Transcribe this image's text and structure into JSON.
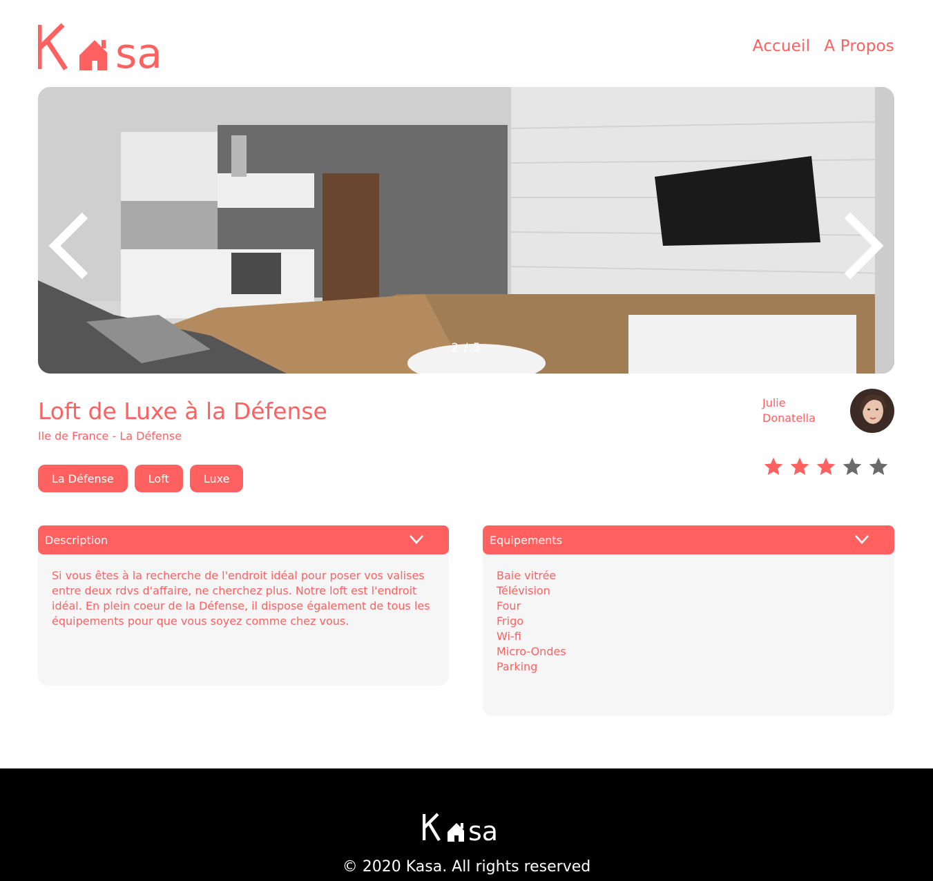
{
  "header": {
    "logo_text": "Kasa",
    "nav": [
      {
        "label": "Accueil"
      },
      {
        "label": "A Propos"
      }
    ]
  },
  "carousel": {
    "current": 2,
    "total": 5,
    "counter": "2 / 5"
  },
  "listing": {
    "title": "Loft de Luxe à la Défense",
    "location": "Ile de France - La Défense",
    "tags": [
      "La Défense",
      "Loft",
      "Luxe"
    ],
    "host": {
      "first_name": "Julie",
      "last_name": "Donatella"
    },
    "rating": 3,
    "rating_max": 5
  },
  "description": {
    "title": "Description",
    "text": "Si vous êtes à la recherche de l'endroit idéal pour poser vos valises entre deux rdvs d'affaire, ne cherchez plus. Notre loft est l'endroit idéal. En plein coeur de la Défense, il dispose également de tous les équipements pour que vous soyez comme chez vous."
  },
  "equipments": {
    "title": "Equipements",
    "items": [
      "Baie vitrée",
      "Télévision",
      "Four",
      "Frigo",
      "Wi-fi",
      "Micro-Ondes",
      "Parking"
    ]
  },
  "footer": {
    "logo_text": "Kasa",
    "copyright": "© 2020 Kasa. All rights reserved"
  },
  "colors": {
    "primary": "#FF6060",
    "panel": "#F6F6F6",
    "footer_bg": "#000000",
    "star_off": "#E3E3E3"
  }
}
